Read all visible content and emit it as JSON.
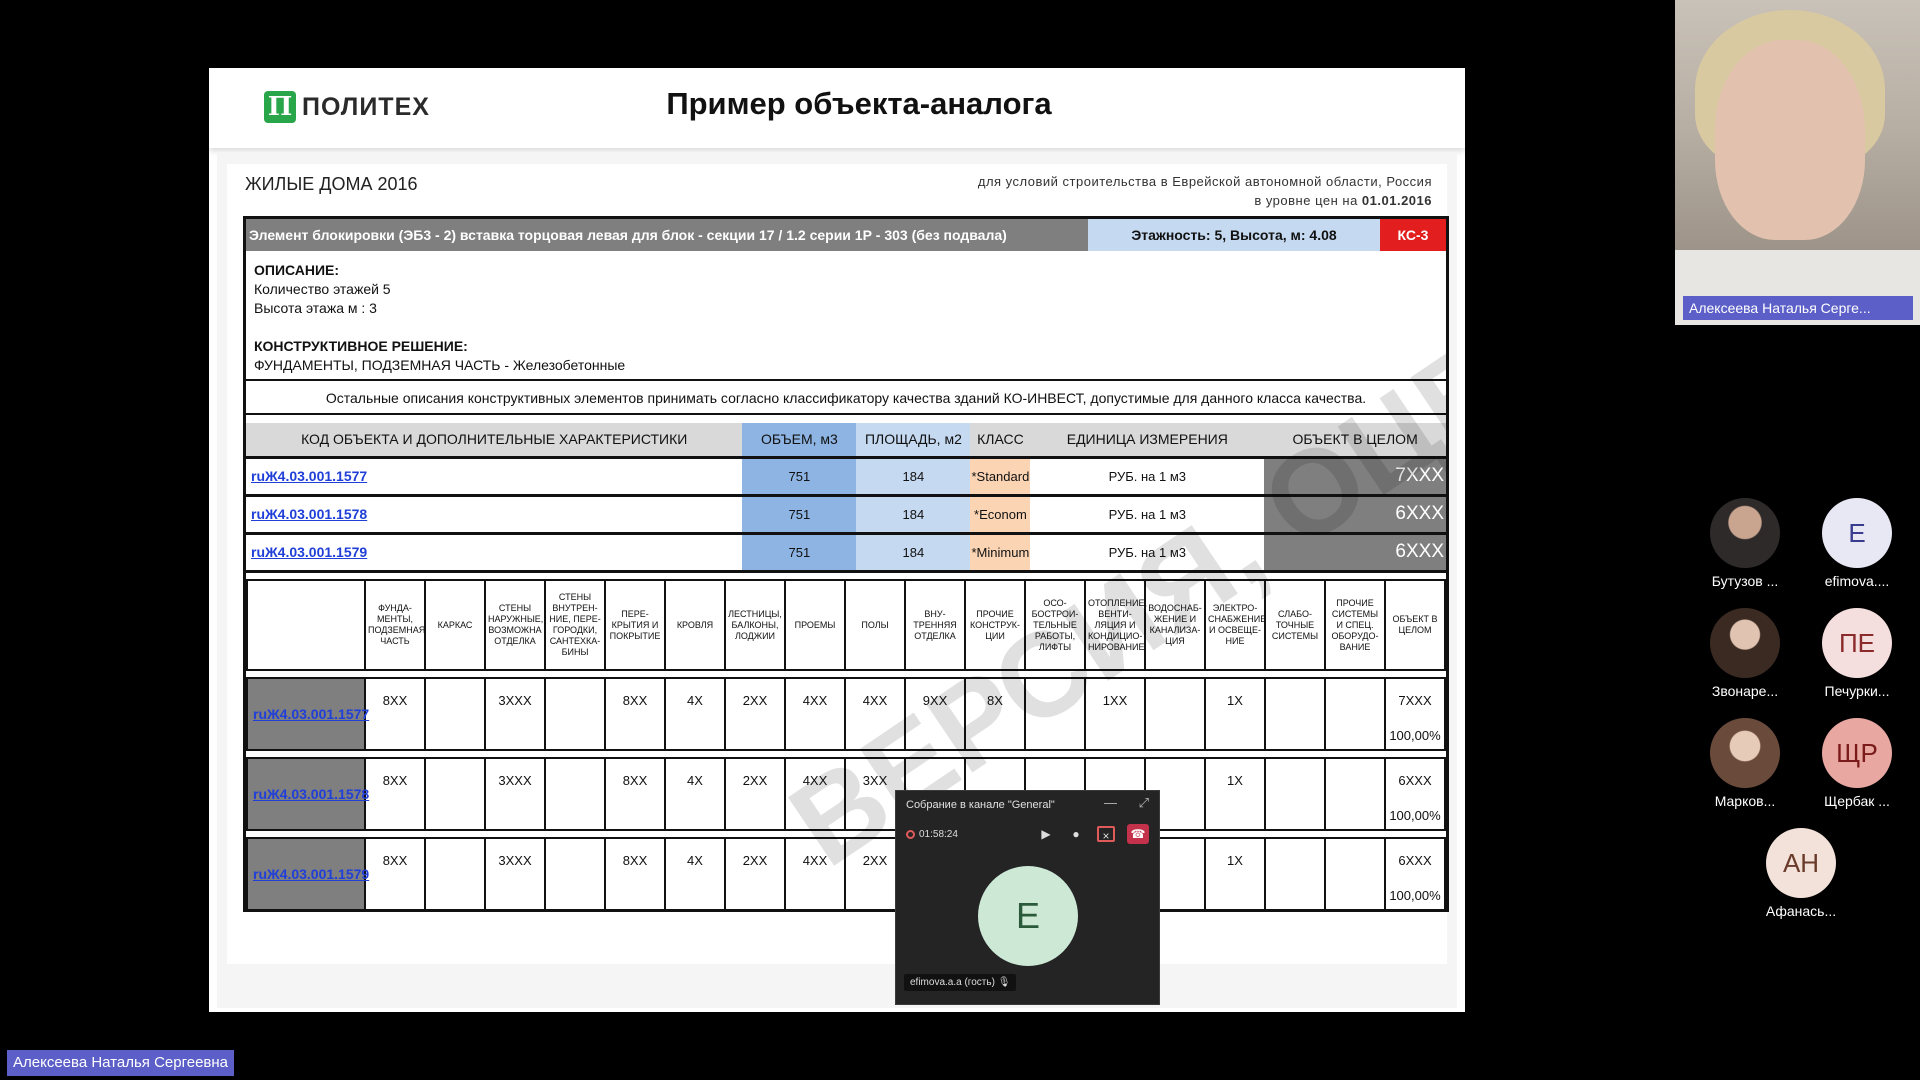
{
  "slide": {
    "logo_mark": "Π",
    "logo_text": "ПОЛИТЕХ",
    "title": "Пример объекта-аналога"
  },
  "doc": {
    "heading": "ЖИЛЫЕ ДОМА 2016",
    "sub_line1": "для условий строительства в Еврейской автономной области, Россия",
    "sub_line2_prefix": "в уровне цен на ",
    "sub_line2_date": "01.01.2016",
    "bar_name": "Элемент блокировки (ЭБ3 - 2) вставка торцовая левая для блок - секции 17 / 1.2 серии 1Р - 303 (без подвала)",
    "bar_floors": "Этажность: 5, Высота, м: 4.08",
    "bar_ks": "КС-3",
    "desc_h1": "ОПИСАНИЕ:",
    "desc_l1": "Количество этажей 5",
    "desc_l2": "Высота этажа м : 3",
    "desc_h2": "КОНСТРУКТИВНОЕ РЕШЕНИЕ:",
    "desc_l3": "ФУНДАМЕНТЫ, ПОДЗЕМНАЯ ЧАСТЬ - Железобетонные",
    "note": "Остальные описания конструктивных элементов принимать согласно классификатору качества зданий КО-ИНВЕСТ, допустимые для данного класса качества.",
    "summary_headers": {
      "code": "КОД ОБЪЕКТА И ДОПОЛНИТЕЛЬНЫЕ ХАРАКТЕРИСТИКИ",
      "vol": "ОБЪЕМ, м3",
      "area": "ПЛОЩАДЬ, м2",
      "cls": "КЛАСС",
      "unit": "ЕДИНИЦА ИЗМЕРЕНИЯ",
      "obj": "ОБЪЕКТ В ЦЕЛОМ"
    },
    "summary_rows": [
      {
        "code": "ruЖ4.03.001.1577",
        "vol": "751",
        "area": "184",
        "cls": "*Standard",
        "unit": "РУБ. на 1 м3",
        "obj": "7XXX"
      },
      {
        "code": "ruЖ4.03.001.1578",
        "vol": "751",
        "area": "184",
        "cls": "*Econom",
        "unit": "РУБ. на 1 м3",
        "obj": "6XXX"
      },
      {
        "code": "ruЖ4.03.001.1579",
        "vol": "751",
        "area": "184",
        "cls": "*Minimum",
        "unit": "РУБ. на 1 м3",
        "obj": "6XXX"
      }
    ],
    "grid_headers": [
      "ФУНДА-МЕНТЫ, ПОДЗЕМНАЯ ЧАСТЬ",
      "КАРКАС",
      "СТЕНЫ НАРУЖНЫЕ, ВОЗМОЖНА ОТДЕЛКА",
      "СТЕНЫ ВНУТРЕН-НИЕ, ПЕРЕ-ГОРОДКИ, САНТЕХКА-БИНЫ",
      "ПЕРЕ-КРЫТИЯ И ПОКРЫТИЕ",
      "КРОВЛЯ",
      "ЛЕСТНИЦЫ, БАЛКОНЫ, ЛОДЖИИ",
      "ПРОЕМЫ",
      "ПОЛЫ",
      "ВНУ-ТРЕННЯЯ ОТДЕЛКА",
      "ПРОЧИЕ КОНСТРУК-ЦИИ",
      "ОСО-БОСТРОИ-ТЕЛЬНЫЕ РАБОТЫ, ЛИФТЫ",
      "ОТОПЛЕНИЕ, ВЕНТИ-ЛЯЦИЯ И КОНДИЦИО-НИРОВАНИЕ",
      "ВОДОСНАБ-ЖЕНИЕ И КАНАЛИЗА-ЦИЯ",
      "ЭЛЕКТРО-СНАБЖЕНИЕ И ОСВЕЩЕ-НИЕ",
      "СЛАБО-ТОЧНЫЕ СИСТЕМЫ",
      "ПРОЧИЕ СИСТЕМЫ И СПЕЦ. ОБОРУДО-ВАНИЕ",
      "ОБЪЕКТ В ЦЕЛОМ"
    ],
    "grid_rows": [
      {
        "code": "ruЖ4.03.001.1577",
        "cells": [
          "8XX",
          "",
          "3XXX",
          "",
          "8XX",
          "4X",
          "2XX",
          "4XX",
          "4XX",
          "9XX",
          "8X",
          "",
          "1XX",
          "",
          "1X",
          "",
          ""
        ],
        "total": "7XXX",
        "pct": "100,00%"
      },
      {
        "code": "ruЖ4.03.001.1578",
        "cells": [
          "8XX",
          "",
          "3XXX",
          "",
          "8XX",
          "4X",
          "2XX",
          "4XX",
          "3XX",
          "",
          "",
          "",
          "",
          "",
          "1X",
          "",
          ""
        ],
        "total": "6XXX",
        "pct": "100,00%"
      },
      {
        "code": "ruЖ4.03.001.1579",
        "cells": [
          "8XX",
          "",
          "3XXX",
          "",
          "8XX",
          "4X",
          "2XX",
          "4XX",
          "2XX",
          "",
          "",
          "",
          "",
          "",
          "1X",
          "",
          ""
        ],
        "total": "6XXX",
        "pct": "100,00%"
      }
    ],
    "watermark": "ВЕРСИЯ, ОЦЕНКА"
  },
  "call": {
    "title": "Собрание в канале \"General\"",
    "timer": "01:58:24",
    "avatar_letter": "E",
    "participant_name": "efimova.a.a (гость)"
  },
  "presenter": {
    "label": "Алексеева Наталья Серге..."
  },
  "participants": [
    {
      "initials": "",
      "name": "Бутузов ...",
      "style": "photo1"
    },
    {
      "initials": "E",
      "name": "efimova....",
      "style": "letter"
    },
    {
      "initials": "",
      "name": "Звонаре...",
      "style": "photo2"
    },
    {
      "initials": "ПЕ",
      "name": "Печурки...",
      "style": "pe"
    },
    {
      "initials": "",
      "name": "Марков...",
      "style": "photo3"
    },
    {
      "initials": "ЩР",
      "name": "Щербак ...",
      "style": "shch"
    },
    {
      "initials": "АН",
      "name": "Афанась...",
      "style": "ah"
    }
  ],
  "bottom_label": "Алексеева Наталья Сергеевна"
}
